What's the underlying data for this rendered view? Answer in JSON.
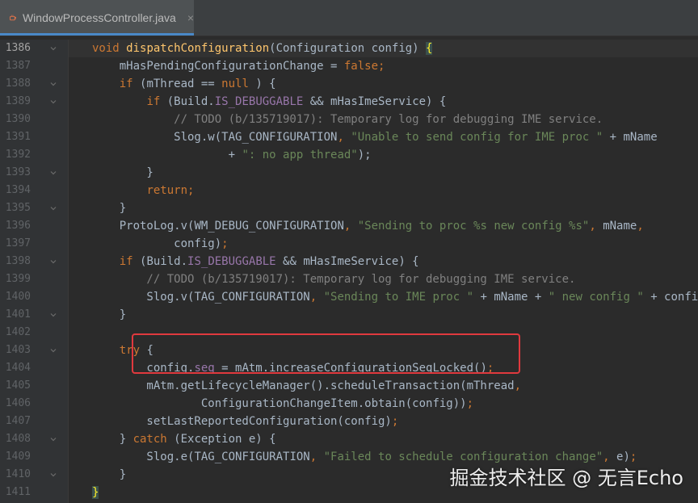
{
  "tab": {
    "title": "WindowProcessController.java",
    "close_label": "×",
    "icon": "java-file-icon"
  },
  "editor": {
    "lines": [
      {
        "num": "1386",
        "fold": "chevron",
        "segs": [
          [
            "kw",
            "void "
          ],
          [
            "fn",
            "dispatchConfiguration"
          ],
          [
            "",
            "(Configuration config) "
          ],
          [
            "brace",
            "{"
          ]
        ]
      },
      {
        "num": "1387",
        "fold": "",
        "segs": [
          [
            "",
            "    mHasPendingConfigurationChange = "
          ],
          [
            "kw",
            "false"
          ],
          [
            "kw",
            ";"
          ]
        ]
      },
      {
        "num": "1388",
        "fold": "chevron",
        "segs": [
          [
            "",
            "    "
          ],
          [
            "kw",
            "if "
          ],
          [
            "",
            "(mThread "
          ],
          [
            "",
            "== "
          ],
          [
            "kw",
            "null"
          ],
          [
            "",
            " ) {"
          ]
        ]
      },
      {
        "num": "1389",
        "fold": "chevron",
        "segs": [
          [
            "",
            "        "
          ],
          [
            "kw",
            "if "
          ],
          [
            "",
            "(Build."
          ],
          [
            "field",
            "IS_DEBUGGABLE"
          ],
          [
            "",
            " && mHasImeService) {"
          ]
        ]
      },
      {
        "num": "1390",
        "fold": "",
        "segs": [
          [
            "cmt",
            "            // TODO (b/135719017): Temporary log for debugging IME service."
          ]
        ]
      },
      {
        "num": "1391",
        "fold": "",
        "segs": [
          [
            "",
            "            Slog."
          ],
          [
            "",
            "w"
          ],
          [
            "",
            "(TAG_CONFIGURATION"
          ],
          [
            "kw",
            ", "
          ],
          [
            "str",
            "\"Unable to send config for IME proc \""
          ],
          [
            "",
            " + mName"
          ]
        ]
      },
      {
        "num": "1392",
        "fold": "",
        "segs": [
          [
            "",
            "                    + "
          ],
          [
            "str",
            "\": no app thread\""
          ],
          [
            "",
            "); "
          ]
        ]
      },
      {
        "num": "1393",
        "fold": "chevron",
        "segs": [
          [
            "",
            "        }"
          ]
        ]
      },
      {
        "num": "1394",
        "fold": "",
        "segs": [
          [
            "",
            "        "
          ],
          [
            "kw",
            "return"
          ],
          [
            "kw",
            ";"
          ]
        ]
      },
      {
        "num": "1395",
        "fold": "chevron",
        "segs": [
          [
            "",
            "    }"
          ]
        ]
      },
      {
        "num": "1396",
        "fold": "",
        "segs": [
          [
            "",
            "    ProtoLog."
          ],
          [
            "",
            "v"
          ],
          [
            "",
            "(WM_DEBUG_CONFIGURATION"
          ],
          [
            "kw",
            ", "
          ],
          [
            "str",
            "\"Sending to proc %s new config %s\""
          ],
          [
            "kw",
            ", "
          ],
          [
            "",
            "mName"
          ],
          [
            "kw",
            ","
          ]
        ]
      },
      {
        "num": "1397",
        "fold": "",
        "segs": [
          [
            "",
            "            config)"
          ],
          [
            "kw",
            ";"
          ]
        ]
      },
      {
        "num": "1398",
        "fold": "chevron",
        "segs": [
          [
            "",
            "    "
          ],
          [
            "kw",
            "if "
          ],
          [
            "",
            "(Build."
          ],
          [
            "field",
            "IS_DEBUGGABLE"
          ],
          [
            "",
            " && mHasImeService) {"
          ]
        ]
      },
      {
        "num": "1399",
        "fold": "",
        "segs": [
          [
            "cmt",
            "        // TODO (b/135719017): Temporary log for debugging IME service."
          ]
        ]
      },
      {
        "num": "1400",
        "fold": "",
        "segs": [
          [
            "",
            "        Slog."
          ],
          [
            "",
            "v"
          ],
          [
            "",
            "(TAG_CONFIGURATION"
          ],
          [
            "kw",
            ", "
          ],
          [
            "str",
            "\"Sending to IME proc \""
          ],
          [
            "",
            " + mName + "
          ],
          [
            "str",
            "\" new config \""
          ],
          [
            "",
            " + config)"
          ],
          [
            "kw",
            ";"
          ]
        ]
      },
      {
        "num": "1401",
        "fold": "chevron",
        "segs": [
          [
            "",
            "    }"
          ]
        ]
      },
      {
        "num": "1402",
        "fold": "",
        "segs": [
          [
            "",
            ""
          ]
        ]
      },
      {
        "num": "1403",
        "fold": "chevron",
        "segs": [
          [
            "",
            "    "
          ],
          [
            "kw",
            "try "
          ],
          [
            "",
            "{"
          ]
        ]
      },
      {
        "num": "1404",
        "fold": "",
        "segs": [
          [
            "",
            "        config."
          ],
          [
            "field",
            "seq"
          ],
          [
            "",
            " = mAtm.increaseConfigurationSeqLocked()"
          ],
          [
            "kw",
            ";"
          ]
        ]
      },
      {
        "num": "1405",
        "fold": "",
        "segs": [
          [
            "",
            "        mAtm.getLifecycleManager().scheduleTransaction(mThread"
          ],
          [
            "kw",
            ","
          ]
        ]
      },
      {
        "num": "1406",
        "fold": "",
        "segs": [
          [
            "",
            "                ConfigurationChangeItem."
          ],
          [
            "",
            "obtain"
          ],
          [
            "",
            "(config))"
          ],
          [
            "kw",
            ";"
          ]
        ]
      },
      {
        "num": "1407",
        "fold": "",
        "segs": [
          [
            "",
            "        setLastReportedConfiguration(config)"
          ],
          [
            "kw",
            ";"
          ]
        ]
      },
      {
        "num": "1408",
        "fold": "chevron",
        "segs": [
          [
            "",
            "    } "
          ],
          [
            "kw",
            "catch "
          ],
          [
            "",
            "(Exception e) {"
          ]
        ]
      },
      {
        "num": "1409",
        "fold": "",
        "segs": [
          [
            "",
            "        Slog."
          ],
          [
            "",
            "e"
          ],
          [
            "",
            "(TAG_CONFIGURATION"
          ],
          [
            "kw",
            ", "
          ],
          [
            "str",
            "\"Failed to schedule configuration change\""
          ],
          [
            "kw",
            ", "
          ],
          [
            "",
            "e)"
          ],
          [
            "kw",
            ";"
          ]
        ]
      },
      {
        "num": "1410",
        "fold": "chevron",
        "segs": [
          [
            "",
            "    }"
          ]
        ]
      },
      {
        "num": "1411",
        "fold": "",
        "segs": [
          [
            "brace",
            "}"
          ]
        ]
      }
    ]
  },
  "watermark": "掘金技术社区 @ 无言Echo",
  "colors": {
    "background": "#2b2b2b",
    "keyword": "#cc7832",
    "function": "#ffc66d",
    "string": "#6a8759",
    "comment": "#808080",
    "field": "#9876aa",
    "highlight_box": "#e0393e"
  }
}
